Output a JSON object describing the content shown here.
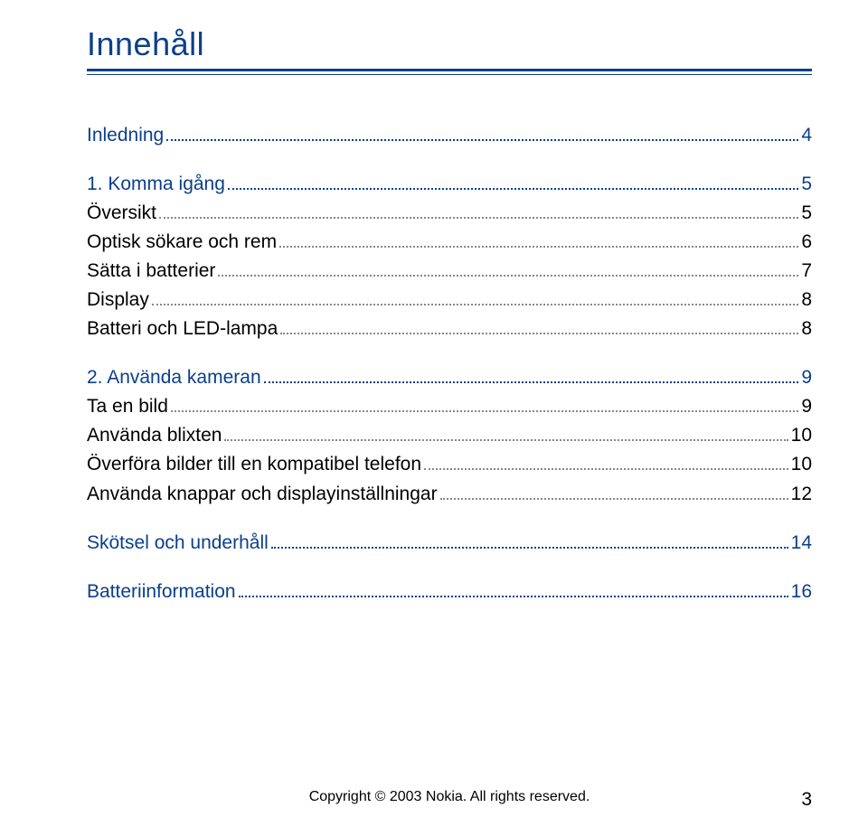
{
  "title": "Innehåll",
  "toc": [
    {
      "label": "Inledning",
      "page": "4",
      "type": "section",
      "sub": false
    },
    {
      "label": "1. Komma igång",
      "page": "5",
      "type": "section",
      "sub": false
    },
    {
      "label": "Översikt",
      "page": "5",
      "type": "sub",
      "sub": true
    },
    {
      "label": "Optisk sökare och rem",
      "page": "6",
      "type": "sub",
      "sub": true
    },
    {
      "label": "Sätta i batterier",
      "page": "7",
      "type": "sub",
      "sub": true
    },
    {
      "label": "Display",
      "page": "8",
      "type": "sub",
      "sub": true
    },
    {
      "label": "Batteri och LED-lampa",
      "page": "8",
      "type": "sub",
      "sub": true
    },
    {
      "label": "2. Använda kameran",
      "page": "9",
      "type": "section",
      "sub": false
    },
    {
      "label": "Ta en bild",
      "page": "9",
      "type": "sub",
      "sub": true
    },
    {
      "label": "Använda blixten",
      "page": "10",
      "type": "sub",
      "sub": true
    },
    {
      "label": "Överföra bilder till en kompatibel telefon",
      "page": "10",
      "type": "sub",
      "sub": true
    },
    {
      "label": "Använda knappar och displayinställningar",
      "page": "12",
      "type": "sub",
      "sub": true
    },
    {
      "label": "Skötsel och underhåll",
      "page": "14",
      "type": "section",
      "sub": false
    },
    {
      "label": "Batteriinformation",
      "page": "16",
      "type": "section",
      "sub": false
    }
  ],
  "footer": {
    "copyright": "Copyright © 2003 Nokia. All rights reserved.",
    "page_number": "3"
  }
}
